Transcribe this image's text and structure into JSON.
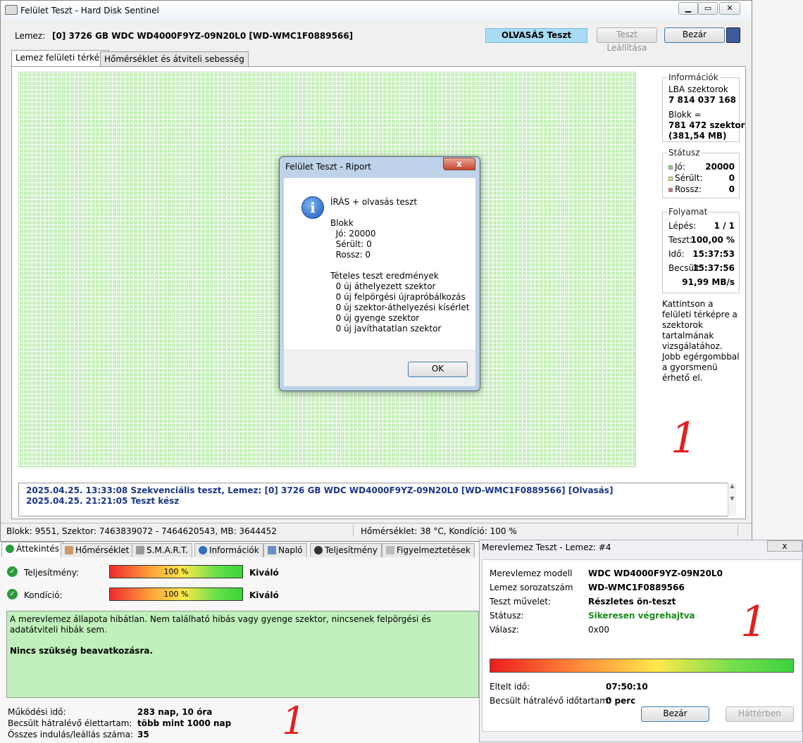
{
  "window": {
    "title": "Felület Teszt - Hard Disk Sentinel",
    "lemez_label": "Lemez:",
    "lemez_value": "[0] 3726 GB  WDC WD4000F9YZ-09N20L0 [WD-WMC1F0889566]",
    "read_test": "OLVASÁS Teszt",
    "stop_btn": "Teszt Leállítása",
    "close_btn": "Bezár",
    "tabs": [
      "Lemez felületi térkép",
      "Hőmérséklet és átviteli sebesség"
    ]
  },
  "info": {
    "title": "Információk",
    "lba_label": "LBA szektorok",
    "lba_value": "7 814 037 168",
    "block_label": "Blokk =",
    "block_value": "781 472 szektor",
    "block_mb": "(381,54 MB)"
  },
  "status": {
    "title": "Státusz",
    "items": [
      {
        "label": "Jó:",
        "value": "20000",
        "color": "#8fdb7d"
      },
      {
        "label": "Sérült:",
        "value": "0",
        "color": "#f4e46b"
      },
      {
        "label": "Rossz:",
        "value": "0",
        "color": "#e06b6b"
      }
    ]
  },
  "progress": {
    "title": "Folyamat",
    "rows": [
      {
        "label": "Lépés:",
        "value": "1 / 1"
      },
      {
        "label": "Teszt:",
        "value": "100,00 %"
      },
      {
        "label": "Idő:",
        "value": "15:37:53"
      },
      {
        "label": "Becsült:",
        "value": "15:37:56"
      }
    ],
    "speed": "91,99 MB/s"
  },
  "help": {
    "text1": "Kattintson a felületi térképre a szektorok tartalmának vizsgálatához.",
    "text2": "Jobb egérgombbal a gyorsmenü érhető el."
  },
  "log": [
    "2025.04.25.  13:33:08   Szekvenciális teszt, Lemez: [0] 3726 GB  WDC WD4000F9YZ-09N20L0 [WD-WMC1F0889566] [Olvasás]",
    "2025.04.25.  21:21:05   Teszt kész"
  ],
  "statusbar": {
    "left": "Blokk: 9551, Szektor: 7463839072 - 7464620543, MB: 3644452",
    "right": "Hőmérséklet: 38  °C,  Kondíció: 100 %"
  },
  "dialog": {
    "title": "Felület Teszt - Riport",
    "close": "x",
    "body": "ÍRÁS + olvasás teszt\n\nBlokk\n  Jó: 20000\n  Sérült: 0\n  Rossz: 0\n\nTételes teszt eredmények\n  0 új áthelyezett szektor\n  0 új felpörgési újrapróbálkozás\n  0 új szektor-áthelyezési kísérlet\n  0 új gyenge szektor\n  0 új javíthatatlan szektor",
    "ok": "OK",
    "icon": "i"
  },
  "overview": {
    "tabs": [
      "Áttekintés",
      "Hőmérséklet",
      "S.M.A.R.T.",
      "Információk",
      "Napló",
      "Teljesítmény",
      "Figyelmeztetések"
    ],
    "perf_label": "Teljesítmény:",
    "perf_value": "100 %",
    "perf_status": "Kiváló",
    "cond_label": "Kondíció:",
    "cond_value": "100 %",
    "cond_status": "Kiváló",
    "perf_level": 1.0,
    "cond_level": 1.0,
    "message": "A merevlemez állapota hibátlan. Nem található hibás vagy gyenge szektor, nincsenek felpörgési és adatátviteli hibák sem.",
    "message_strong": "Nincs szükség beavatkozásra.",
    "kv": [
      {
        "label": "Működési idő:",
        "value": "283 nap, 10 óra"
      },
      {
        "label": "Becsült hátralévő élettartam:",
        "value": "több mint 1000 nap"
      },
      {
        "label": "Összes indulás/leállás száma:",
        "value": "35"
      }
    ]
  },
  "hdtest": {
    "title": "Merevlemez Teszt - Lemez: #4",
    "close": "x",
    "rows": [
      {
        "label": "Merevlemez modell",
        "value": "WDC WD4000F9YZ-09N20L0"
      },
      {
        "label": "Lemez sorozatszám",
        "value": "WD-WMC1F0889566"
      },
      {
        "label": "Teszt művelet:",
        "value": "Részletes ön-teszt"
      },
      {
        "label": "Státusz:",
        "value": "Sikeresen végrehajtva"
      },
      {
        "label": "Válasz:",
        "value": "0x00"
      }
    ],
    "progress_level": 1.0,
    "elapsed_label": "Eltelt idő:",
    "elapsed_value": "07:50:10",
    "remaining_label": "Becsült hátralévő időtartam:",
    "remaining_value": "0 perc",
    "close_btn": "Bezár",
    "bg_btn": "Háttérben",
    "status_color": "#1a8c1a"
  },
  "annotations": {
    "mark": "1"
  }
}
